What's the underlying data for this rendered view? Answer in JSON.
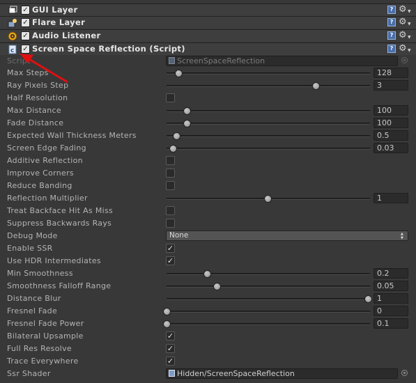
{
  "components": [
    {
      "name": "gui-layer",
      "title": "GUI Layer",
      "icon": "gui-layer-icon",
      "enabled": true
    },
    {
      "name": "flare-layer",
      "title": "Flare Layer",
      "icon": "flare-layer-icon",
      "enabled": true
    },
    {
      "name": "audio-listener",
      "title": "Audio Listener",
      "icon": "audio-listener-icon",
      "enabled": true
    },
    {
      "name": "ssr-script",
      "title": "Screen Space Reflection (Script)",
      "icon": "script-icon",
      "enabled": true
    }
  ],
  "help_icon": "help-icon",
  "settings_icon": "gear-icon",
  "script": {
    "label": "Script",
    "value": "ScreenSpaceReflection"
  },
  "properties": [
    {
      "label": "Max Steps",
      "kind": "slider",
      "value": "128",
      "fraction": 0.06
    },
    {
      "label": "Ray Pixels Step",
      "kind": "slider",
      "value": "3",
      "fraction": 0.74
    },
    {
      "label": "Half Resolution",
      "kind": "toggle",
      "checked": false
    },
    {
      "label": "Max Distance",
      "kind": "slider",
      "value": "100",
      "fraction": 0.1
    },
    {
      "label": "Fade Distance",
      "kind": "slider",
      "value": "100",
      "fraction": 0.1
    },
    {
      "label": "Expected Wall Thickness Meters",
      "kind": "slider",
      "value": "0.5",
      "fraction": 0.05
    },
    {
      "label": "Screen Edge Fading",
      "kind": "slider",
      "value": "0.03",
      "fraction": 0.03
    },
    {
      "label": "Additive Reflection",
      "kind": "toggle",
      "checked": false
    },
    {
      "label": "Improve Corners",
      "kind": "toggle",
      "checked": false
    },
    {
      "label": "Reduce Banding",
      "kind": "toggle",
      "checked": false
    },
    {
      "label": "Reflection Multiplier",
      "kind": "slider",
      "value": "1",
      "fraction": 0.5
    },
    {
      "label": "Treat Backface Hit As Miss",
      "kind": "toggle",
      "checked": false
    },
    {
      "label": "Suppress Backwards Rays",
      "kind": "toggle",
      "checked": false
    },
    {
      "label": "Debug Mode",
      "kind": "dropdown",
      "value": "None"
    },
    {
      "label": "Enable SSR",
      "kind": "toggle",
      "checked": true
    },
    {
      "label": "Use HDR Intermediates",
      "kind": "toggle",
      "checked": true
    },
    {
      "label": "Min Smoothness",
      "kind": "slider",
      "value": "0.2",
      "fraction": 0.2
    },
    {
      "label": "Smoothness Falloff Range",
      "kind": "slider",
      "value": "0.05",
      "fraction": 0.25
    },
    {
      "label": "Distance Blur",
      "kind": "slider",
      "value": "1",
      "fraction": 1.0
    },
    {
      "label": "Fresnel Fade",
      "kind": "slider",
      "value": "0",
      "fraction": 0.0
    },
    {
      "label": "Fresnel Fade Power",
      "kind": "slider",
      "value": "0.1",
      "fraction": 0.0
    },
    {
      "label": "Bilateral Upsample",
      "kind": "toggle",
      "checked": true
    },
    {
      "label": "Full Res Resolve",
      "kind": "toggle",
      "checked": true
    },
    {
      "label": "Trace Everywhere",
      "kind": "toggle",
      "checked": true
    },
    {
      "label": "Ssr Shader",
      "kind": "object",
      "value": "Hidden/ScreenSpaceReflection"
    }
  ],
  "colors": {
    "background": "#383838",
    "header": "#3e3e3e",
    "annotation_arrow": "#e01010"
  }
}
